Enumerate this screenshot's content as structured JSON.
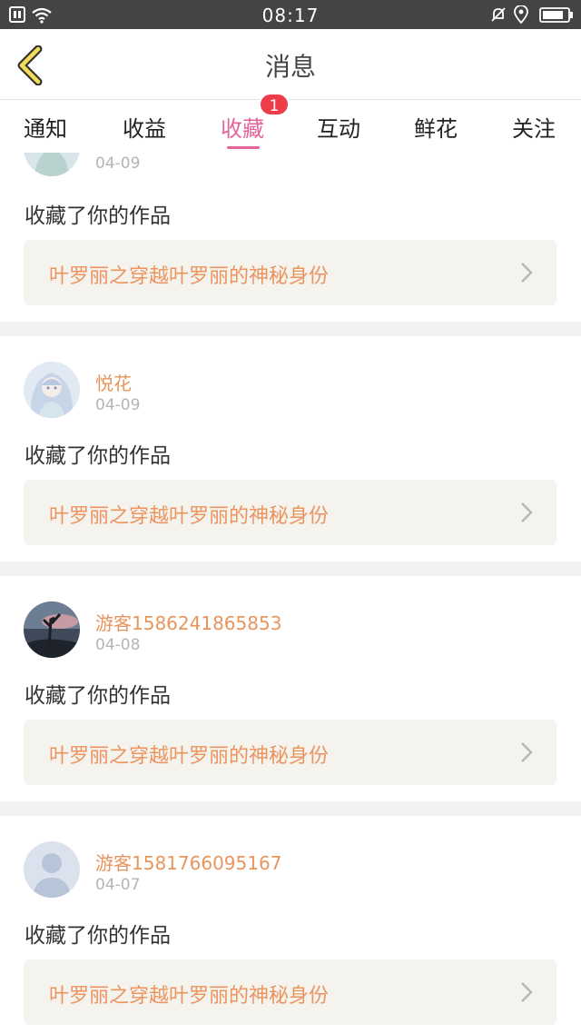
{
  "status": {
    "time": "08:17"
  },
  "header": {
    "title": "消息"
  },
  "tabs": [
    {
      "label": "通知"
    },
    {
      "label": "收益"
    },
    {
      "label": "收藏"
    },
    {
      "label": "互动"
    },
    {
      "label": "鲜花"
    },
    {
      "label": "关注"
    }
  ],
  "active_tab": "收藏",
  "badge": "1",
  "items": [
    {
      "user": "",
      "date": "04-09",
      "action": "收藏了你的作品",
      "work": "叶罗丽之穿越叶罗丽的神秘身份",
      "avatar": "anime-girl-avatar"
    },
    {
      "user": "悦花",
      "date": "04-09",
      "action": "收藏了你的作品",
      "work": "叶罗丽之穿越叶罗丽的神秘身份",
      "avatar": "anime-girl-avatar"
    },
    {
      "user": "游客1586241865853",
      "date": "04-08",
      "action": "收藏了你的作品",
      "work": "叶罗丽之穿越叶罗丽的神秘身份",
      "avatar": "landscape-avatar"
    },
    {
      "user": "游客1581766095167",
      "date": "04-07",
      "action": "收藏了你的作品",
      "work": "叶罗丽之穿越叶罗丽的神秘身份",
      "avatar": "default-user-avatar"
    }
  ]
}
